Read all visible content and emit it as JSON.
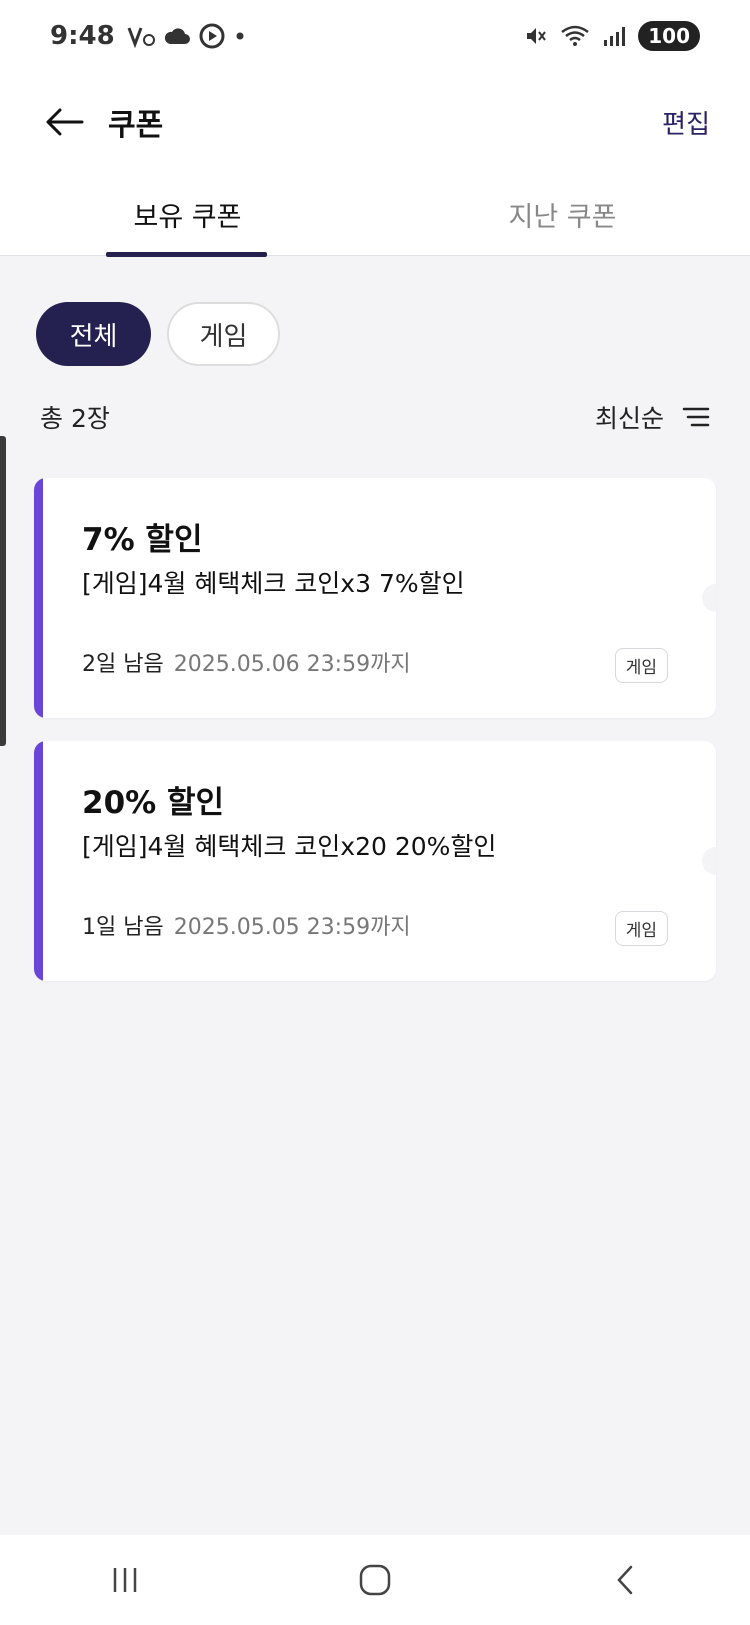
{
  "status_bar": {
    "time": "9:48",
    "battery": "100",
    "icons": [
      "volte-icon",
      "cloud-icon",
      "play-icon",
      "dot-icon",
      "mute-icon",
      "wifi-icon",
      "signal-icon"
    ]
  },
  "header": {
    "title": "쿠폰",
    "edit_label": "편집"
  },
  "tabs": [
    {
      "label": "보유 쿠폰",
      "active": true
    },
    {
      "label": "지난 쿠폰",
      "active": false
    }
  ],
  "filters": [
    {
      "label": "전체",
      "active": true
    },
    {
      "label": "게임",
      "active": false
    }
  ],
  "summary": {
    "total": "총 2장",
    "sort_label": "최신순"
  },
  "coupons": [
    {
      "title": "7% 할인",
      "description": "[게임]4월 혜택체크 코인x3 7%할인",
      "remaining": "2일 남음",
      "until": "2025.05.06 23:59까지",
      "tag": "게임"
    },
    {
      "title": "20% 할인",
      "description": "[게임]4월 혜택체크 코인x20 20%할인",
      "remaining": "1일 남음",
      "until": "2025.05.05 23:59까지",
      "tag": "게임"
    }
  ],
  "colors": {
    "accent": "#6a46d8",
    "primary_dark": "#24204f",
    "background": "#f4f4f6"
  }
}
